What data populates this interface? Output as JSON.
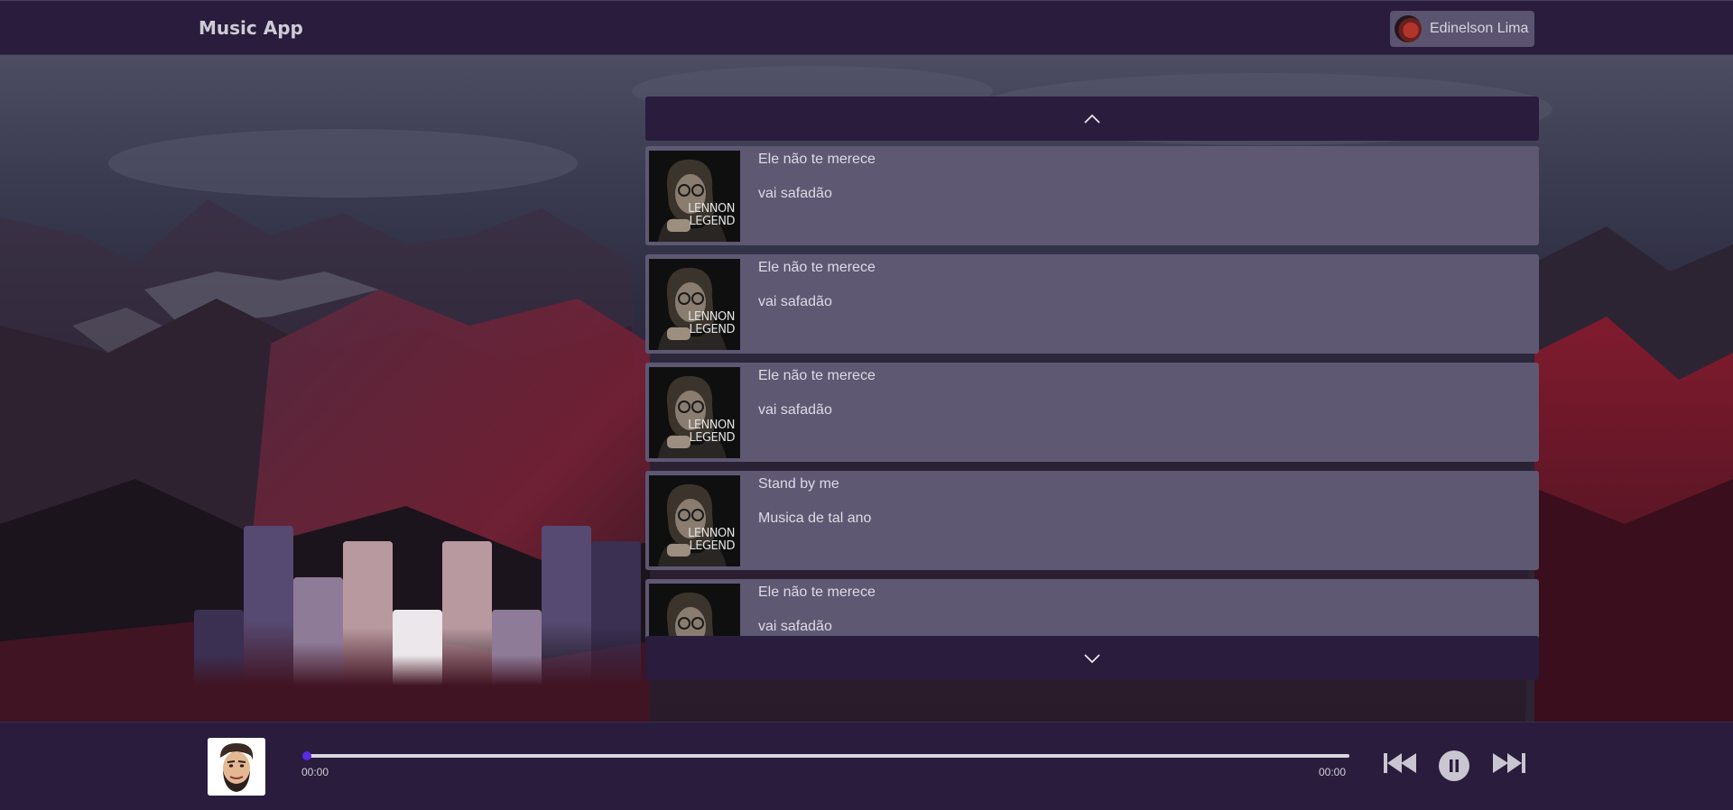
{
  "app": {
    "title": "Music App"
  },
  "user": {
    "name": "Edinelson Lima"
  },
  "playlist": {
    "tracks": [
      {
        "title": "Ele não te merece",
        "artist": "vai safadão"
      },
      {
        "title": "Ele não te merece",
        "artist": "vai safadão"
      },
      {
        "title": "Ele não te merece",
        "artist": "vai safadão"
      },
      {
        "title": "Stand by me",
        "artist": "Musica de tal ano"
      },
      {
        "title": "Ele não te merece",
        "artist": "vai safadão"
      }
    ],
    "scroll_up_icon": "chevron-up-icon",
    "scroll_down_icon": "chevron-down-icon",
    "cover_text": [
      "LENNON",
      "LEGEND"
    ]
  },
  "visualizer": {
    "levels": [
      0.44,
      0.93,
      0.63,
      0.84,
      0.44,
      0.84,
      0.44,
      0.93,
      0.84
    ],
    "colors": [
      "#3b2f52",
      "#564a72",
      "#8e7b98",
      "#b8999f",
      "#ece7ea",
      "#b8999f",
      "#8e7b98",
      "#564a72",
      "#3b2f52"
    ]
  },
  "player": {
    "current_time": "00:00",
    "total_time": "00:00",
    "progress": 0,
    "prev_icon": "skip-back-icon",
    "pause_icon": "pause-icon",
    "next_icon": "skip-forward-icon"
  },
  "colors": {
    "header_bg": "#291c3c",
    "track_bg": "#5e5873",
    "accent": "#5a2be2"
  }
}
